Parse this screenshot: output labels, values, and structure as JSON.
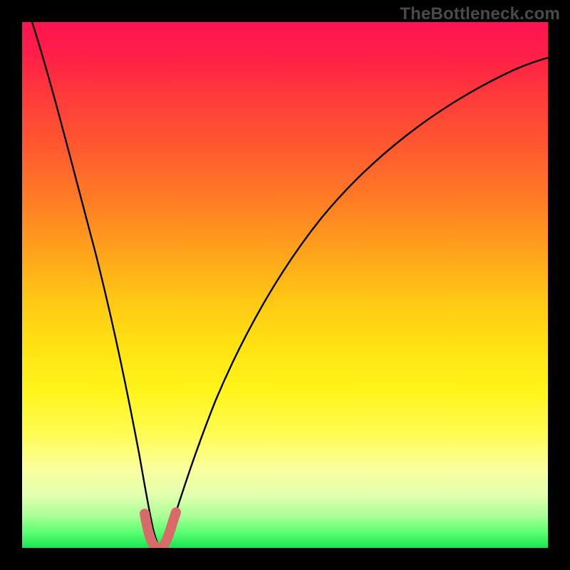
{
  "watermark": "TheBottleneck.com",
  "chart_data": {
    "type": "line",
    "title": "",
    "xlabel": "",
    "ylabel": "",
    "xlim": [
      0,
      100
    ],
    "ylim": [
      0,
      100
    ],
    "grid": false,
    "series": [
      {
        "name": "bottleneck-curve",
        "color": "#000000",
        "x": [
          2,
          6,
          10,
          14,
          18,
          20,
          22,
          23,
          24,
          25,
          26,
          27,
          28,
          30,
          34,
          40,
          48,
          58,
          70,
          84,
          100
        ],
        "y": [
          100,
          84,
          68,
          52,
          34,
          22,
          12,
          7,
          3,
          1,
          1,
          3,
          7,
          14,
          27,
          42,
          56,
          68,
          78,
          85,
          90
        ]
      },
      {
        "name": "valley-highlight",
        "color": "#d86a6a",
        "x": [
          22,
          23,
          24,
          25,
          26,
          27,
          28
        ],
        "y": [
          12,
          7,
          3,
          1,
          3,
          7,
          12
        ]
      }
    ],
    "gradient_stops": [
      {
        "pos": 0,
        "color": "#ff1452"
      },
      {
        "pos": 50,
        "color": "#ffc815"
      },
      {
        "pos": 80,
        "color": "#fbff9e"
      },
      {
        "pos": 100,
        "color": "#18e653"
      }
    ],
    "valley_x": 25
  }
}
